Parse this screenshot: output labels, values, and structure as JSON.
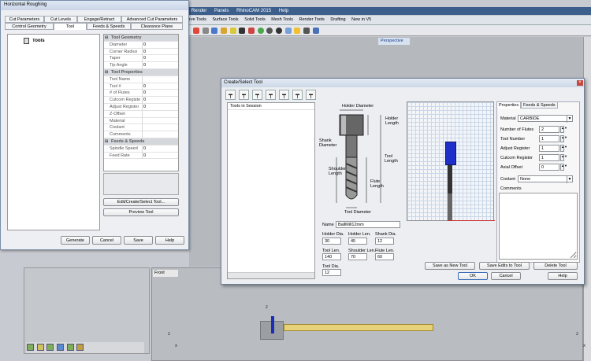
{
  "app": {
    "menu": [
      "alyze",
      "Render",
      "Panels",
      "RhinoCAM 2015",
      "Help"
    ],
    "tabs": [
      "rm",
      "Curve Tools",
      "Surface Tools",
      "Solid Tools",
      "Mesh Tools",
      "Render Tools",
      "Drafting",
      "New in V5"
    ],
    "viewport_top_label": "Perspective",
    "viewport_bottom_label": "Front",
    "axis_z": "z",
    "axis_x": "x"
  },
  "hr_window": {
    "title": "Horizontal Roughing",
    "tabs_row1": [
      "Cut Parameters",
      "Cut Levels",
      "Engage/Retract",
      "Advanced Cut Parameters"
    ],
    "tabs_row2": [
      "Control Geometry",
      "Tool",
      "Feeds & Speeds",
      "Clearance Plane"
    ],
    "tree_root": "Tools",
    "groups": [
      {
        "name": "Tool Geometry",
        "rows": [
          {
            "k": "Diameter",
            "v": "0"
          },
          {
            "k": "Corner Radius",
            "v": "0"
          },
          {
            "k": "Taper",
            "v": "0"
          },
          {
            "k": "Tip Angle",
            "v": "0"
          }
        ]
      },
      {
        "name": "Tool Properties",
        "rows": [
          {
            "k": "Tool Name",
            "v": ""
          },
          {
            "k": "Tool #",
            "v": "0"
          },
          {
            "k": "# of Flutes",
            "v": "0"
          },
          {
            "k": "Cutcom Registe",
            "v": "0"
          },
          {
            "k": "Adjust Register",
            "v": "0"
          },
          {
            "k": "Z-Offset",
            "v": ""
          },
          {
            "k": "Material",
            "v": ""
          },
          {
            "k": "Coolant",
            "v": ""
          },
          {
            "k": "Comments",
            "v": ""
          }
        ]
      },
      {
        "name": "Feeds & Speeds",
        "rows": [
          {
            "k": "Spindle Speed",
            "v": "0"
          },
          {
            "k": "Feed Rate",
            "v": "0"
          }
        ]
      }
    ],
    "edit_tool_btn": "Edit/Create/Select Tool...",
    "preview_tool_btn": "Preview Tool",
    "generate_btn": "Generate",
    "cancel_btn": "Cancel",
    "save_btn": "Save",
    "help_btn": "Help"
  },
  "cs_window": {
    "title": "Create/Select Tool",
    "tools_in_session": "Tools in Session",
    "diagram": {
      "holder_diameter": "Holder Diameter",
      "holder_length": "Holder\nLength",
      "shank_diameter": "Shank\nDiameter",
      "shoulder_length": "Shoulder\nLength",
      "tool_length": "Tool\nLength",
      "flute_length": "Flute\nLength",
      "tool_diameter": "Tool Diameter"
    },
    "name_label": "Name",
    "name_value": "BallMill12mm",
    "fields": [
      {
        "label": "Holder Dia.",
        "value": "30"
      },
      {
        "label": "Holder Len.",
        "value": "45"
      },
      {
        "label": "Shank Dia.",
        "value": "12"
      },
      {
        "label": "Tool Len.",
        "value": "140"
      },
      {
        "label": "Shoulder Len.",
        "value": "70"
      },
      {
        "label": "Flute Len.",
        "value": "60"
      },
      {
        "label": "Tool Dia.",
        "value": "12"
      }
    ],
    "tabs": [
      "Properties",
      "Feeds & Speeds"
    ],
    "material_label": "Material",
    "material_value": "CARBIDE",
    "props": [
      {
        "label": "Number of Flutes",
        "value": "2"
      },
      {
        "label": "Tool Number",
        "value": "1"
      },
      {
        "label": "Adjust Register",
        "value": "1"
      },
      {
        "label": "Cutcom Register",
        "value": "1"
      },
      {
        "label": "Axial Offset",
        "value": "0"
      }
    ],
    "coolant_label": "Coolant",
    "coolant_value": "None",
    "comments_label": "Comments",
    "save_new_btn": "Save as New Tool",
    "save_edits_btn": "Save Edits to Tool",
    "delete_btn": "Delete Tool",
    "ok_btn": "OK",
    "cancel_btn": "Cancel",
    "help_btn": "Help"
  },
  "colors": {
    "accent_blue": "#1a2cb8",
    "sim_grid": "#c9d7e8"
  }
}
